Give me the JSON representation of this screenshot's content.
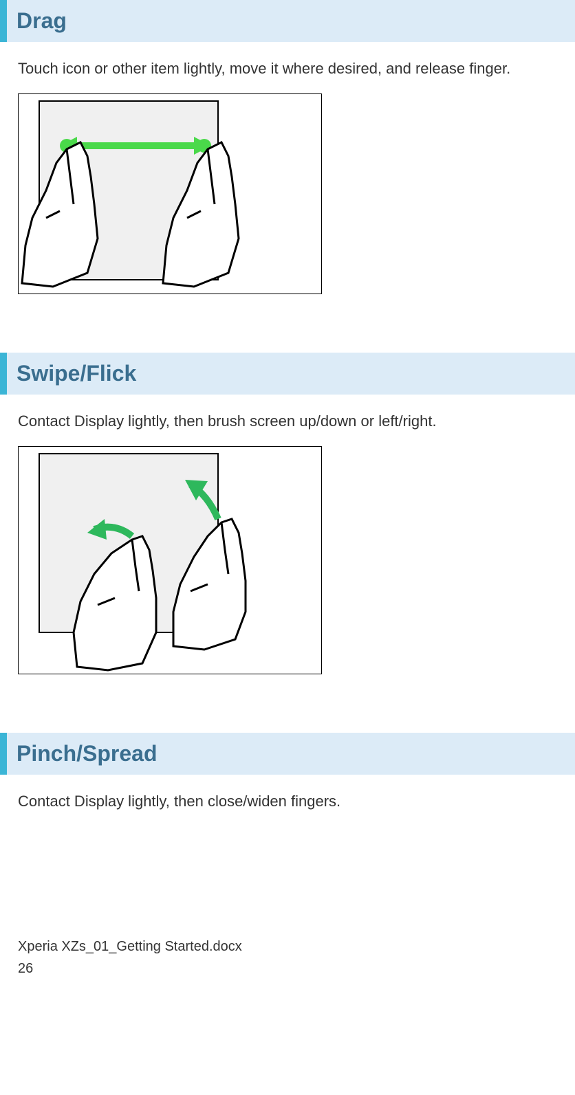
{
  "sections": [
    {
      "title": "Drag",
      "description": "Touch icon or other item lightly, move it where desired, and release finger."
    },
    {
      "title": "Swipe/Flick",
      "description": "Contact Display lightly, then brush screen up/down or left/right."
    },
    {
      "title": "Pinch/Spread",
      "description": "Contact Display lightly, then close/widen fingers."
    }
  ],
  "footer": {
    "filename": "Xperia XZs_01_Getting Started.docx",
    "page_number": "26"
  }
}
